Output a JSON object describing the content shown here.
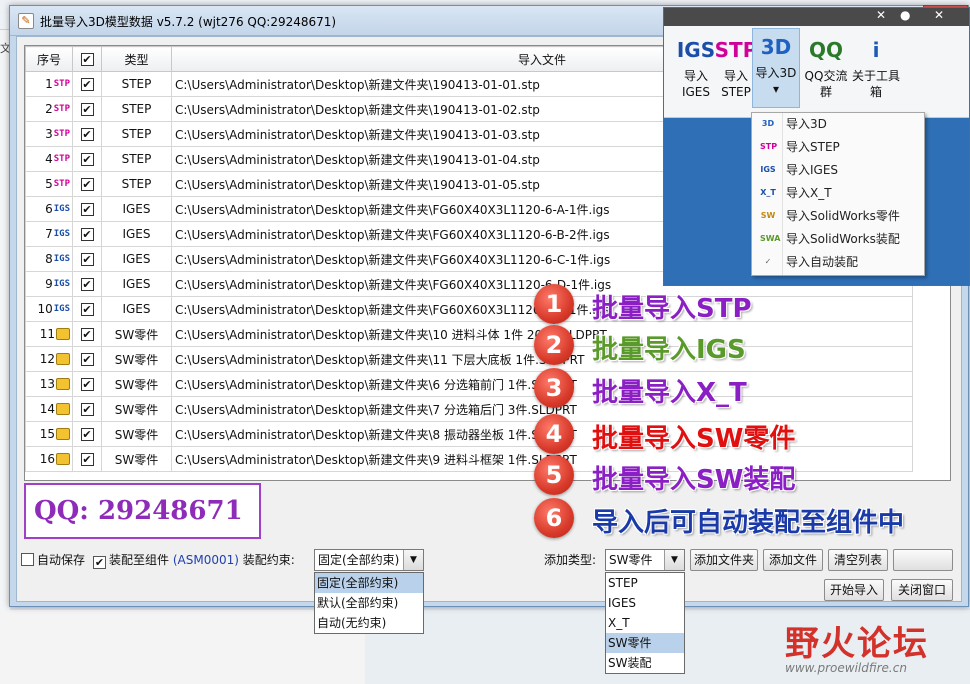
{
  "window": {
    "title": "批量导入3D模型数据  v5.7.2 (wjt276 QQ:29248671)",
    "close_glyph": "✕"
  },
  "table": {
    "headers": [
      "序号",
      "✔",
      "类型",
      "导入文件"
    ],
    "rows": [
      {
        "num": "1",
        "type": "STEP",
        "icon": "stp",
        "path": "C:\\Users\\Administrator\\Desktop\\新建文件夹\\190413-01-01.stp"
      },
      {
        "num": "2",
        "type": "STEP",
        "icon": "stp",
        "path": "C:\\Users\\Administrator\\Desktop\\新建文件夹\\190413-01-02.stp"
      },
      {
        "num": "3",
        "type": "STEP",
        "icon": "stp",
        "path": "C:\\Users\\Administrator\\Desktop\\新建文件夹\\190413-01-03.stp"
      },
      {
        "num": "4",
        "type": "STEP",
        "icon": "stp",
        "path": "C:\\Users\\Administrator\\Desktop\\新建文件夹\\190413-01-04.stp"
      },
      {
        "num": "5",
        "type": "STEP",
        "icon": "stp",
        "path": "C:\\Users\\Administrator\\Desktop\\新建文件夹\\190413-01-05.stp"
      },
      {
        "num": "6",
        "type": "IGES",
        "icon": "igs",
        "path": "C:\\Users\\Administrator\\Desktop\\新建文件夹\\FG60X40X3L1120-6-A-1件.igs"
      },
      {
        "num": "7",
        "type": "IGES",
        "icon": "igs",
        "path": "C:\\Users\\Administrator\\Desktop\\新建文件夹\\FG60X40X3L1120-6-B-2件.igs"
      },
      {
        "num": "8",
        "type": "IGES",
        "icon": "igs",
        "path": "C:\\Users\\Administrator\\Desktop\\新建文件夹\\FG60X40X3L1120-6-C-1件.igs"
      },
      {
        "num": "9",
        "type": "IGES",
        "icon": "igs",
        "path": "C:\\Users\\Administrator\\Desktop\\新建文件夹\\FG60X40X3L1120-6-D-1件.igs"
      },
      {
        "num": "10",
        "type": "IGES",
        "icon": "igs",
        "path": "C:\\Users\\Administrator\\Desktop\\新建文件夹\\FG60X60X3L1120-6-A-1件.igs"
      },
      {
        "num": "11",
        "type": "SW零件",
        "icon": "sw",
        "path": "C:\\Users\\Administrator\\Desktop\\新建文件夹\\10  进料斗体  1件  2019.SLDPRT"
      },
      {
        "num": "12",
        "type": "SW零件",
        "icon": "sw",
        "path": "C:\\Users\\Administrator\\Desktop\\新建文件夹\\11 下层大底板  1件.SLDPRT"
      },
      {
        "num": "13",
        "type": "SW零件",
        "icon": "sw",
        "path": "C:\\Users\\Administrator\\Desktop\\新建文件夹\\6  分选箱前门    1件.SLDPRT"
      },
      {
        "num": "14",
        "type": "SW零件",
        "icon": "sw",
        "path": "C:\\Users\\Administrator\\Desktop\\新建文件夹\\7  分选箱后门    3件.SLDPRT"
      },
      {
        "num": "15",
        "type": "SW零件",
        "icon": "sw",
        "path": "C:\\Users\\Administrator\\Desktop\\新建文件夹\\8  振动器坐板   1件.SLDPRT"
      },
      {
        "num": "16",
        "type": "SW零件",
        "icon": "sw",
        "path": "C:\\Users\\Administrator\\Desktop\\新建文件夹\\9  进料斗框架  1件.SLDPRT"
      }
    ]
  },
  "icons": {
    "stp": "STP",
    "igs": "IGS",
    "sw": ""
  },
  "annotations": [
    {
      "n": "1",
      "text": "批量导入STP",
      "color": "#8a1fc4"
    },
    {
      "n": "2",
      "text": "批量导入IGS",
      "color": "#5a9a2a"
    },
    {
      "n": "3",
      "text": "批量导入X_T",
      "color": "#8a1fc4"
    },
    {
      "n": "4",
      "text": "批量导入SW零件",
      "color": "#e01010"
    },
    {
      "n": "5",
      "text": "批量导入SW装配",
      "color": "#8a1fc4"
    },
    {
      "n": "6",
      "text": "导入后可自动装配至组件中",
      "color": "#1a3aa8"
    }
  ],
  "qq": {
    "label": "QQ:  29248671"
  },
  "controls": {
    "auto_save": "自动保存",
    "assemble_to": "装配至组件",
    "asm_name": "(ASM0001)",
    "constraint_label": "装配约束:",
    "constraint_value": "固定(全部约束)",
    "constraint_options": [
      "固定(全部约束)",
      "默认(全部约束)",
      "自动(无约束)"
    ],
    "add_type_label": "添加类型:",
    "add_type_value": "SW零件",
    "add_type_options": [
      "STEP",
      "IGES",
      "X_T",
      "SW零件",
      "SW装配"
    ],
    "add_folder": "添加文件夹",
    "add_file": "添加文件",
    "clear_list": "清空列表",
    "start_import": "开始导入",
    "close_window": "关闭窗口"
  },
  "ribbon": {
    "buttons": [
      {
        "icon": "IGS",
        "label": "导入\nIGES"
      },
      {
        "icon": "STP",
        "label": "导入\nSTEP"
      },
      {
        "icon": "3D",
        "label": "导入3D\n▾"
      },
      {
        "icon": "QQ",
        "label": "QQ交流\n群"
      },
      {
        "icon": "i",
        "label": "关于工具\n箱"
      }
    ],
    "menu": [
      "导入3D",
      "导入STEP",
      "导入IGES",
      "导入X_T",
      "导入SolidWorks零件",
      "导入SolidWorks装配",
      "导入自动装配"
    ],
    "menu_icons": [
      "3D",
      "STP",
      "IGS",
      "X_T",
      "SW",
      "SWA",
      "✓"
    ]
  },
  "watermark": {
    "name": "野火论坛",
    "url": "www.proewildfire.cn"
  },
  "colors": {
    "accent": "#2e6fb5",
    "close": "#c75050",
    "qq_border": "#a040c8",
    "selection": "#b9d1ea"
  }
}
